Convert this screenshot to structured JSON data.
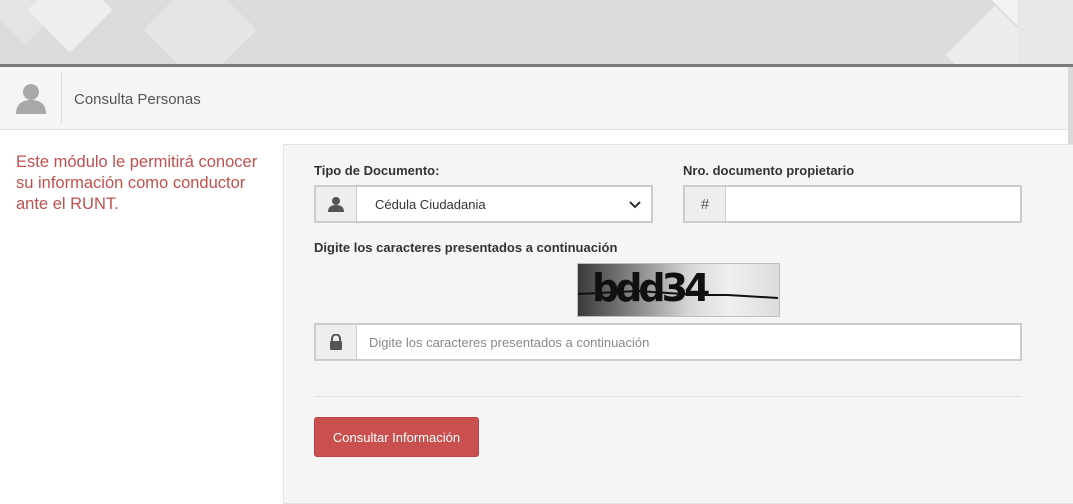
{
  "header": {
    "title": "Consulta Personas",
    "icon": "user-icon"
  },
  "intro": {
    "text": "Este módulo le permitirá conocer su información como conductor ante el RUNT."
  },
  "form": {
    "tipo_documento": {
      "label": "Tipo de Documento:",
      "selected": "Cédula Ciudadania",
      "icon": "user-icon"
    },
    "nro_documento": {
      "label": "Nro. documento propietario",
      "addon": "#",
      "value": ""
    },
    "captcha": {
      "label": "Digite los caracteres presentados a continuación",
      "image_text": "bdd34",
      "placeholder": "Digite los caracteres presentados a continuación",
      "icon": "lock-icon"
    },
    "submit_label": "Consultar Información"
  },
  "colors": {
    "accent": "#c9504f",
    "intro_text": "#c0504d",
    "panel_bg": "#f5f5f5"
  }
}
